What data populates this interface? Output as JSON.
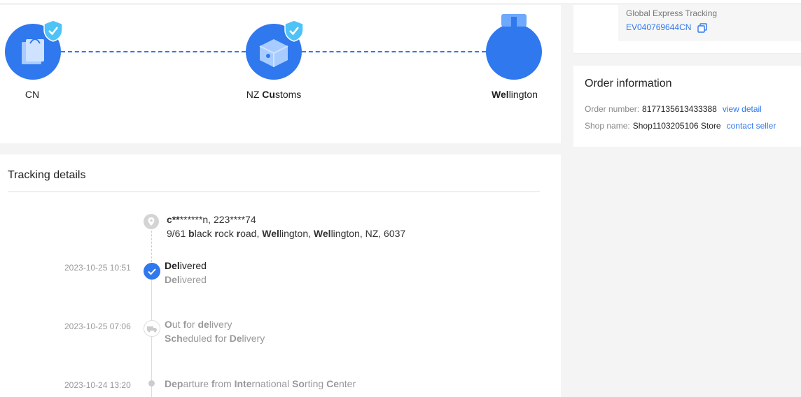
{
  "progress": {
    "nodes": [
      {
        "label_parts": [
          {
            "text": "CN",
            "bold": false
          }
        ]
      },
      {
        "label_parts": [
          {
            "text": "NZ ",
            "bold": false
          },
          {
            "text": "Cu",
            "bold": true
          },
          {
            "text": "stoms",
            "bold": false
          }
        ]
      },
      {
        "label_parts": [
          {
            "text": "Wel",
            "bold": true
          },
          {
            "text": "lington",
            "bold": false
          }
        ]
      }
    ],
    "accent_color": "#2f78ee"
  },
  "express": {
    "name": "Global Express Tracking",
    "number": "EV040769644CN"
  },
  "order": {
    "title": "Order information",
    "number_label": "Order number:",
    "number_value": "8177135613433388",
    "number_link": "view detail",
    "shop_label": "Shop name:",
    "shop_value": "Shop1103205106 Store",
    "shop_link": "contact seller"
  },
  "tracking": {
    "title": "Tracking details",
    "address": {
      "name_parts": [
        {
          "text": "c",
          "bold": true
        },
        {
          "text": "**",
          "bold": true
        },
        {
          "text": "******n,  223****74",
          "bold": false
        }
      ],
      "line2_parts": [
        {
          "text": "9/61 ",
          "bold": false
        },
        {
          "text": "b",
          "bold": true
        },
        {
          "text": "lack ",
          "bold": false
        },
        {
          "text": "r",
          "bold": true
        },
        {
          "text": "ock ",
          "bold": false
        },
        {
          "text": "r",
          "bold": true
        },
        {
          "text": "oad,  ",
          "bold": false
        },
        {
          "text": "Wel",
          "bold": true
        },
        {
          "text": "lington,  ",
          "bold": false
        },
        {
          "text": "Wel",
          "bold": true
        },
        {
          "text": "lington,  NZ,  6037",
          "bold": false
        }
      ]
    },
    "events": [
      {
        "time": "2023-10-25 10:51",
        "title_parts": [
          {
            "text": "Del",
            "bold": true
          },
          {
            "text": "ivered",
            "bold": false
          }
        ],
        "sub_parts": [
          {
            "text": "Del",
            "bold": true
          },
          {
            "text": "ivered",
            "bold": false
          }
        ],
        "active": true
      },
      {
        "time": "2023-10-25 07:06",
        "title_parts": [
          {
            "text": "O",
            "bold": true
          },
          {
            "text": "ut ",
            "bold": false
          },
          {
            "text": "f",
            "bold": true
          },
          {
            "text": "or ",
            "bold": false
          },
          {
            "text": "de",
            "bold": true
          },
          {
            "text": "livery",
            "bold": false
          }
        ],
        "sub_parts": [
          {
            "text": "Sch",
            "bold": true
          },
          {
            "text": "eduled ",
            "bold": false
          },
          {
            "text": "f",
            "bold": true
          },
          {
            "text": "or ",
            "bold": false
          },
          {
            "text": "De",
            "bold": true
          },
          {
            "text": "livery",
            "bold": false
          }
        ],
        "active": false
      },
      {
        "time": "2023-10-24 13:20",
        "title_parts": [
          {
            "text": "Dep",
            "bold": true
          },
          {
            "text": "arture ",
            "bold": false
          },
          {
            "text": "f",
            "bold": true
          },
          {
            "text": "rom ",
            "bold": false
          },
          {
            "text": "Inte",
            "bold": true
          },
          {
            "text": "rnational ",
            "bold": false
          },
          {
            "text": "So",
            "bold": true
          },
          {
            "text": "rting ",
            "bold": false
          },
          {
            "text": "Ce",
            "bold": true
          },
          {
            "text": "nter",
            "bold": false
          }
        ],
        "sub_parts": [],
        "active": false
      }
    ]
  }
}
